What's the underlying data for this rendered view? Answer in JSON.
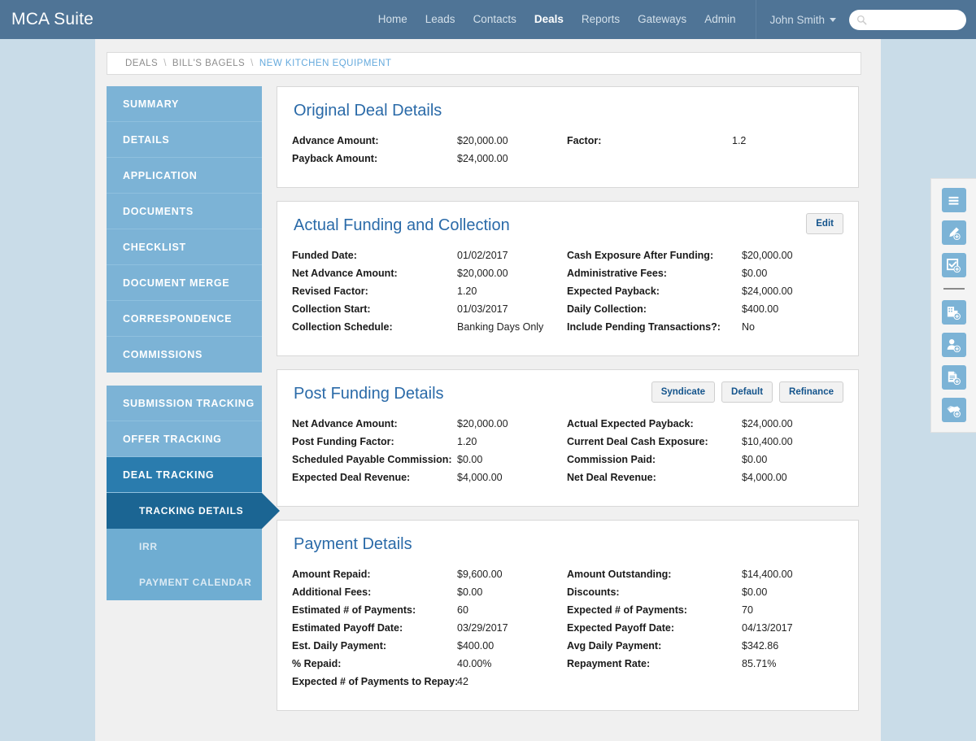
{
  "header": {
    "brand": "MCA Suite",
    "nav": [
      {
        "label": "Home",
        "active": false
      },
      {
        "label": "Leads",
        "active": false
      },
      {
        "label": "Contacts",
        "active": false
      },
      {
        "label": "Deals",
        "active": true
      },
      {
        "label": "Reports",
        "active": false
      },
      {
        "label": "Gateways",
        "active": false
      },
      {
        "label": "Admin",
        "active": false
      }
    ],
    "user": "John Smith",
    "search_placeholder": "",
    "search_value": "",
    "search_icon": "search-icon",
    "bg_color": "#4f7496"
  },
  "breadcrumb": {
    "items": [
      "DEALS",
      "BILL'S BAGELS",
      "NEW KITCHEN EQUIPMENT"
    ],
    "separator": "\\",
    "current_color": "#66aadd"
  },
  "sidebar": {
    "group1": [
      {
        "label": "SUMMARY"
      },
      {
        "label": "DETAILS"
      },
      {
        "label": "APPLICATION"
      },
      {
        "label": "DOCUMENTS"
      },
      {
        "label": "CHECKLIST"
      },
      {
        "label": "DOCUMENT MERGE"
      },
      {
        "label": "CORRESPONDENCE"
      },
      {
        "label": "COMMISSIONS"
      }
    ],
    "group2": [
      {
        "label": "SUBMISSION TRACKING"
      },
      {
        "label": "OFFER TRACKING"
      },
      {
        "label": "DEAL TRACKING"
      },
      {
        "label": "TRACKING DETAILS"
      },
      {
        "label": "IRR"
      },
      {
        "label": "PAYMENT CALENDAR"
      }
    ],
    "active_color": "#1b6593",
    "active_parent_color": "#2a7cae",
    "base_color": "#7cb3d6"
  },
  "panels": {
    "original_deal": {
      "title": "Original Deal Details",
      "rows": [
        {
          "left_label": "Advance Amount:",
          "left_value": "$20,000.00",
          "right_label": "Factor:",
          "right_value": "1.2"
        },
        {
          "left_label": "Payback Amount:",
          "left_value": "$24,000.00",
          "right_label": "",
          "right_value": ""
        }
      ]
    },
    "actual_funding": {
      "title": "Actual Funding and Collection",
      "edit_label": "Edit",
      "rows": [
        {
          "left_label": "Funded Date:",
          "left_value": "01/02/2017",
          "right_label": "Cash Exposure After Funding:",
          "right_value": "$20,000.00"
        },
        {
          "left_label": "Net Advance Amount:",
          "left_value": "$20,000.00",
          "right_label": "Administrative Fees:",
          "right_value": "$0.00"
        },
        {
          "left_label": "Revised Factor:",
          "left_value": "1.20",
          "right_label": "Expected Payback:",
          "right_value": "$24,000.00"
        },
        {
          "left_label": "Collection Start:",
          "left_value": "01/03/2017",
          "right_label": "Daily Collection:",
          "right_value": "$400.00"
        },
        {
          "left_label": "Collection Schedule:",
          "left_value": "Banking Days Only",
          "right_label": "Include Pending Transactions?:",
          "right_value": "No"
        }
      ]
    },
    "post_funding": {
      "title": "Post Funding Details",
      "buttons": [
        "Syndicate",
        "Default",
        "Refinance"
      ],
      "rows": [
        {
          "left_label": "Net Advance Amount:",
          "left_value": "$20,000.00",
          "right_label": "Actual Expected Payback:",
          "right_value": "$24,000.00"
        },
        {
          "left_label": "Post Funding Factor:",
          "left_value": "1.20",
          "right_label": "Current Deal Cash Exposure:",
          "right_value": "$10,400.00"
        },
        {
          "left_label": "Scheduled Payable Commission:",
          "left_value": "$0.00",
          "right_label": "Commission Paid:",
          "right_value": "$0.00"
        },
        {
          "left_label": "Expected Deal Revenue:",
          "left_value": "$4,000.00",
          "right_label": "Net Deal Revenue:",
          "right_value": "$4,000.00"
        }
      ]
    },
    "payment_details": {
      "title": "Payment Details",
      "rows": [
        {
          "left_label": "Amount Repaid:",
          "left_value": "$9,600.00",
          "right_label": "Amount Outstanding:",
          "right_value": "$14,400.00"
        },
        {
          "left_label": "Additional Fees:",
          "left_value": "$0.00",
          "right_label": "Discounts:",
          "right_value": "$0.00"
        },
        {
          "left_label": "Estimated # of Payments:",
          "left_value": "60",
          "right_label": "Expected # of Payments:",
          "right_value": "70"
        },
        {
          "left_label": "Estimated Payoff Date:",
          "left_value": "03/29/2017",
          "right_label": "Expected Payoff Date:",
          "right_value": "04/13/2017"
        },
        {
          "left_label": "Est. Daily Payment:",
          "left_value": "$400.00",
          "right_label": "Avg Daily Payment:",
          "right_value": "$342.86"
        },
        {
          "left_label": "% Repaid:",
          "left_value": "40.00%",
          "right_label": "Repayment Rate:",
          "right_value": "85.71%"
        },
        {
          "left_label": "Expected # of Payments to Repay:",
          "left_value": "42",
          "right_label": "",
          "right_value": ""
        }
      ]
    }
  },
  "tooldock": {
    "icons": [
      "menu-list-icon",
      "add-note-icon",
      "add-task-icon",
      "divider",
      "add-company-icon",
      "add-contact-icon",
      "add-document-icon",
      "add-deal-icon"
    ],
    "icon_color": "#7cb3d6"
  }
}
